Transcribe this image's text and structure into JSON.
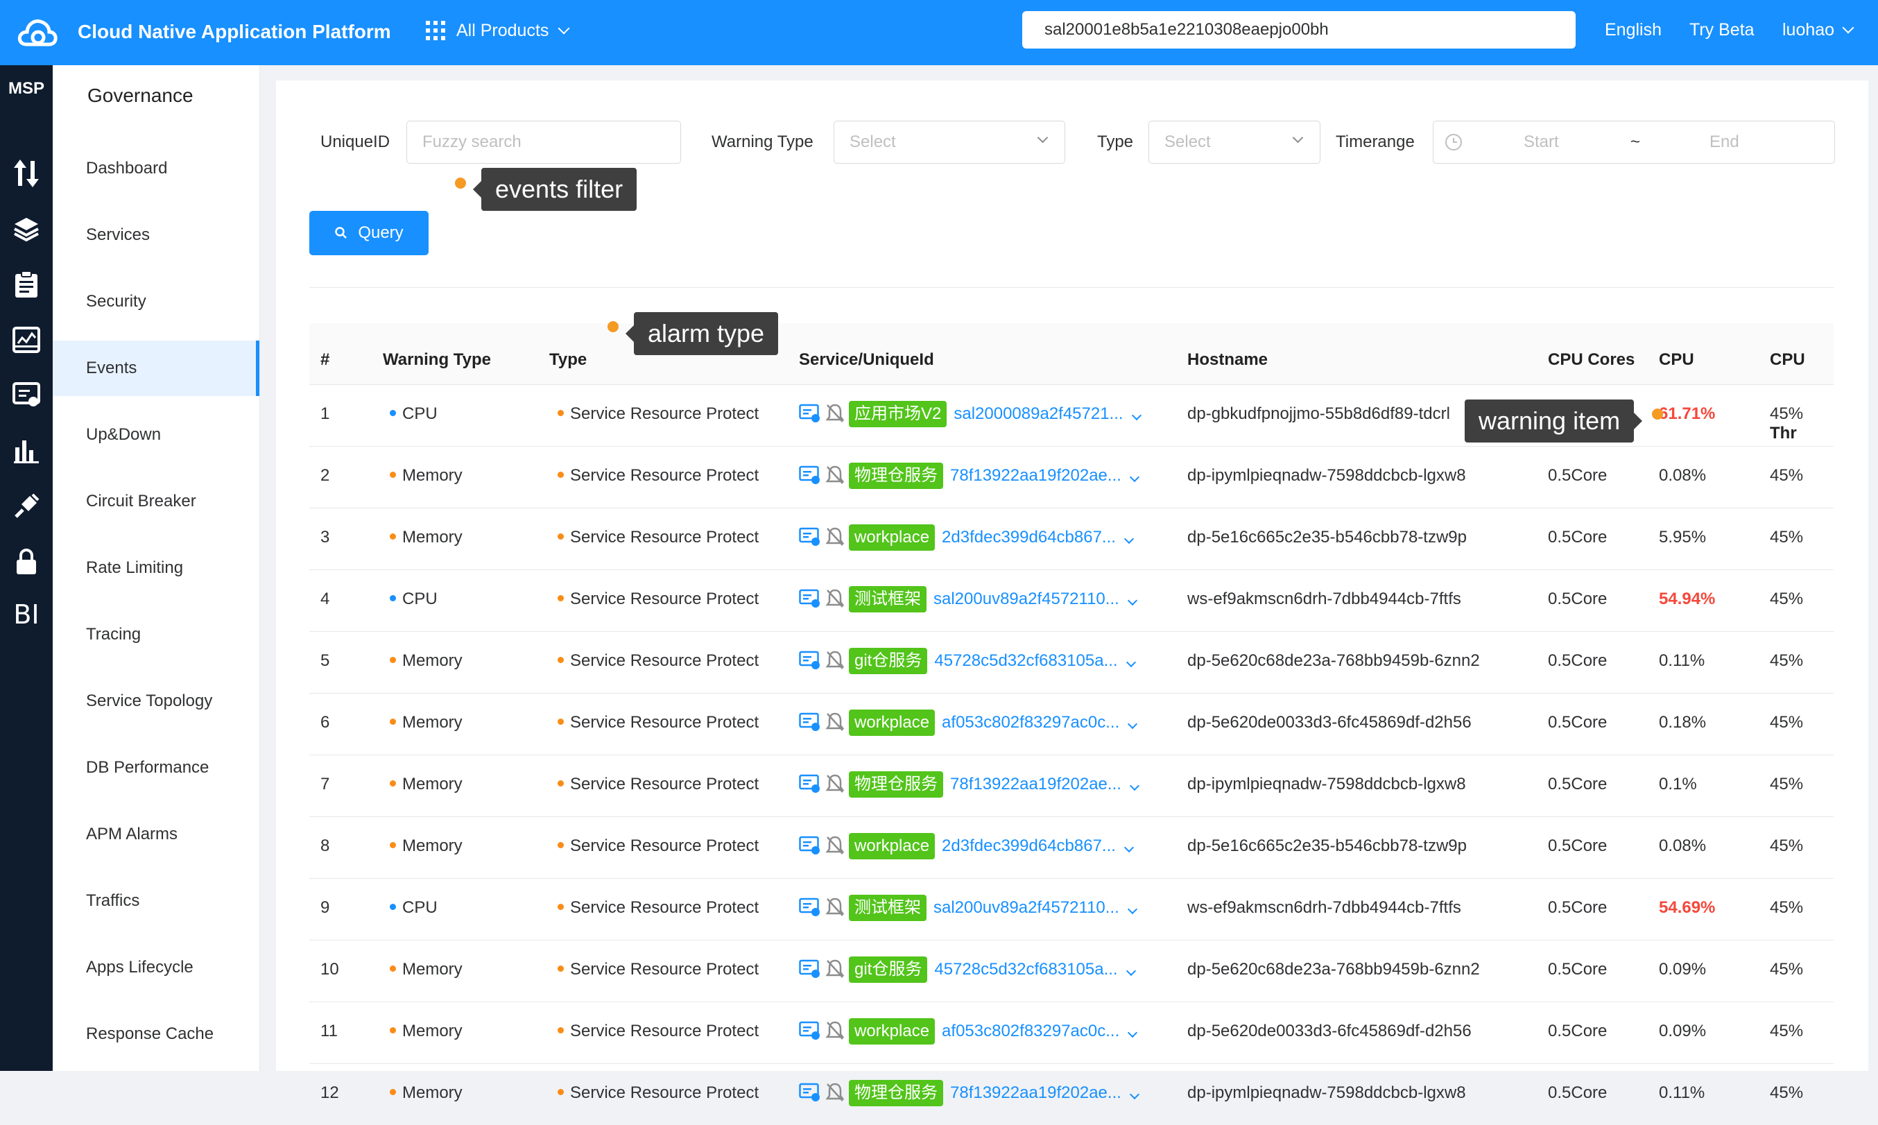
{
  "header": {
    "title": "Cloud Native Application Platform",
    "products_label": "All Products",
    "org_value": "sal20001e8b5a1e2210308eaepjo00bh",
    "language": "English",
    "try_beta": "Try Beta",
    "user": "luohao"
  },
  "iconbar": {
    "msp_label": "MSP",
    "bi_label": "BI",
    "icons": [
      "transfer-icon",
      "layers-icon",
      "clipboard-icon",
      "dashboard-screen-icon",
      "monitor-service-icon",
      "bar-chart-icon",
      "plugin-icon",
      "lock-icon",
      "bi-icon"
    ]
  },
  "sidebar": {
    "title": "Governance",
    "items": [
      {
        "label": "Dashboard"
      },
      {
        "label": "Services"
      },
      {
        "label": "Security"
      },
      {
        "label": "Events"
      },
      {
        "label": "Up&Down"
      },
      {
        "label": "Circuit Breaker"
      },
      {
        "label": "Rate Limiting"
      },
      {
        "label": "Tracing"
      },
      {
        "label": "Service Topology"
      },
      {
        "label": "DB Performance"
      },
      {
        "label": "APM Alarms"
      },
      {
        "label": "Traffics"
      },
      {
        "label": "Apps Lifecycle"
      },
      {
        "label": "Response Cache"
      }
    ],
    "active": "Events"
  },
  "filters": {
    "uniqueid_label": "UniqueID",
    "uniqueid_placeholder": "Fuzzy search",
    "warning_type_label": "Warning Type",
    "warning_type_placeholder": "Select",
    "type_label": "Type",
    "type_placeholder": "Select",
    "timerange_label": "Timerange",
    "start_placeholder": "Start",
    "separator": "~",
    "end_placeholder": "End",
    "query_label": "Query"
  },
  "annotations": {
    "events_filter": "events filter",
    "alarm_type": "alarm type",
    "warning_item": "warning item"
  },
  "colors": {
    "primary": "#1890ff",
    "cpu_dot": "#1890ff",
    "memory_dot": "#fa8c16",
    "tag_green": "#52c41a",
    "alert_red": "#f5483b",
    "annotation_dot": "#f59a23"
  },
  "table": {
    "columns": [
      "#",
      "Warning Type",
      "Type",
      "Service/UniqueId",
      "Hostname",
      "CPU Cores",
      "CPU",
      "CPU Thr"
    ],
    "rows": [
      {
        "no": "1",
        "warning": "CPU",
        "type": "Service Resource Protect",
        "tag": "应用市场V2",
        "uid": "sal2000089a2f45721...",
        "host": "dp-gbkudfpnojjmo-55b8d6df89-tdcrl",
        "cores": "0.5Core",
        "cpu": "61.71%",
        "thr": "45%",
        "alert": true
      },
      {
        "no": "2",
        "warning": "Memory",
        "type": "Service Resource Protect",
        "tag": "物理仓服务",
        "uid": "78f13922aa19f202ae...",
        "host": "dp-ipymlpieqnadw-7598ddcbcb-lgxw8",
        "cores": "0.5Core",
        "cpu": "0.08%",
        "thr": "45%",
        "alert": false
      },
      {
        "no": "3",
        "warning": "Memory",
        "type": "Service Resource Protect",
        "tag": "workplace",
        "uid": "2d3fdec399d64cb867...",
        "host": "dp-5e16c665c2e35-b546cbb78-tzw9p",
        "cores": "0.5Core",
        "cpu": "5.95%",
        "thr": "45%",
        "alert": false
      },
      {
        "no": "4",
        "warning": "CPU",
        "type": "Service Resource Protect",
        "tag": "测试框架",
        "uid": "sal200uv89a2f4572110...",
        "host": "ws-ef9akmscn6drh-7dbb4944cb-7ftfs",
        "cores": "0.5Core",
        "cpu": "54.94%",
        "thr": "45%",
        "alert": true
      },
      {
        "no": "5",
        "warning": "Memory",
        "type": "Service Resource Protect",
        "tag": "git仓服务",
        "uid": "45728c5d32cf683105a...",
        "host": "dp-5e620c68de23a-768bb9459b-6znn2",
        "cores": "0.5Core",
        "cpu": "0.11%",
        "thr": "45%",
        "alert": false
      },
      {
        "no": "6",
        "warning": "Memory",
        "type": "Service Resource Protect",
        "tag": "workplace",
        "uid": "af053c802f83297ac0c...",
        "host": "dp-5e620de0033d3-6fc45869df-d2h56",
        "cores": "0.5Core",
        "cpu": "0.18%",
        "thr": "45%",
        "alert": false
      },
      {
        "no": "7",
        "warning": "Memory",
        "type": "Service Resource Protect",
        "tag": "物理仓服务",
        "uid": "78f13922aa19f202ae...",
        "host": "dp-ipymlpieqnadw-7598ddcbcb-lgxw8",
        "cores": "0.5Core",
        "cpu": "0.1%",
        "thr": "45%",
        "alert": false
      },
      {
        "no": "8",
        "warning": "Memory",
        "type": "Service Resource Protect",
        "tag": "workplace",
        "uid": "2d3fdec399d64cb867...",
        "host": "dp-5e16c665c2e35-b546cbb78-tzw9p",
        "cores": "0.5Core",
        "cpu": "0.08%",
        "thr": "45%",
        "alert": false
      },
      {
        "no": "9",
        "warning": "CPU",
        "type": "Service Resource Protect",
        "tag": "测试框架",
        "uid": "sal200uv89a2f4572110...",
        "host": "ws-ef9akmscn6drh-7dbb4944cb-7ftfs",
        "cores": "0.5Core",
        "cpu": "54.69%",
        "thr": "45%",
        "alert": true
      },
      {
        "no": "10",
        "warning": "Memory",
        "type": "Service Resource Protect",
        "tag": "git仓服务",
        "uid": "45728c5d32cf683105a...",
        "host": "dp-5e620c68de23a-768bb9459b-6znn2",
        "cores": "0.5Core",
        "cpu": "0.09%",
        "thr": "45%",
        "alert": false
      },
      {
        "no": "11",
        "warning": "Memory",
        "type": "Service Resource Protect",
        "tag": "workplace",
        "uid": "af053c802f83297ac0c...",
        "host": "dp-5e620de0033d3-6fc45869df-d2h56",
        "cores": "0.5Core",
        "cpu": "0.09%",
        "thr": "45%",
        "alert": false
      },
      {
        "no": "12",
        "warning": "Memory",
        "type": "Service Resource Protect",
        "tag": "物理仓服务",
        "uid": "78f13922aa19f202ae...",
        "host": "dp-ipymlpieqnadw-7598ddcbcb-lgxw8",
        "cores": "0.5Core",
        "cpu": "0.11%",
        "thr": "45%",
        "alert": false
      }
    ]
  }
}
